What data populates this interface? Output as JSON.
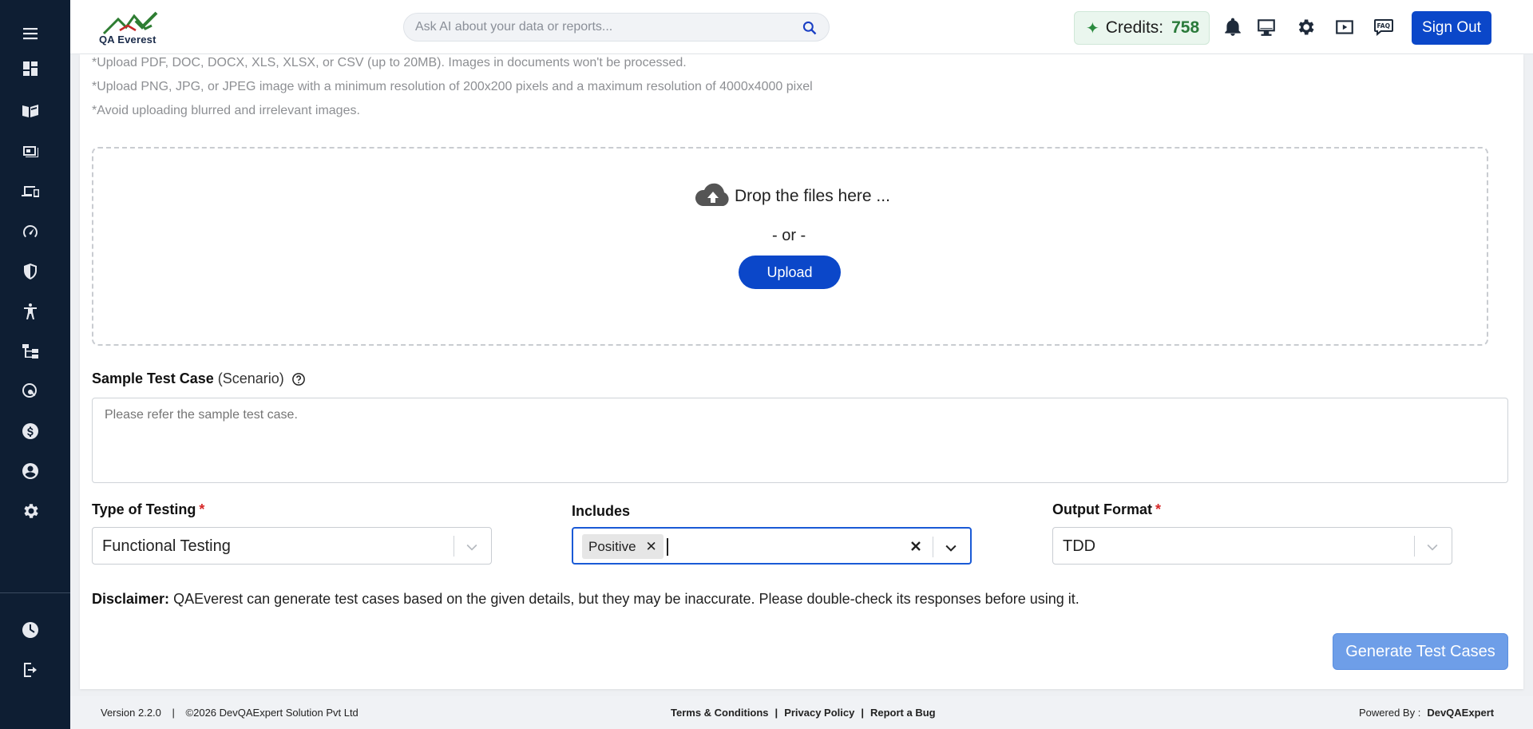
{
  "header": {
    "logo_text": "QA Everest",
    "search_placeholder": "Ask AI about your data or reports...",
    "credits_label": "Credits:",
    "credits_value": "758",
    "signout_label": "Sign Out"
  },
  "upload": {
    "notes": [
      "*Upload PDF, DOC, DOCX, XLS, XLSX, or CSV (up to 20MB). Images in documents won't be processed.",
      "*Upload PNG, JPG, or JPEG image with a minimum resolution of 200x200 pixels and a maximum resolution of 4000x4000 pixel",
      "*Avoid uploading blurred and irrelevant images."
    ],
    "drop_text": "Drop the files here ...",
    "or_text": "- or -",
    "upload_label": "Upload"
  },
  "sample": {
    "label": "Sample Test Case",
    "sub_label": "(Scenario)",
    "placeholder": "Please refer the sample test case."
  },
  "type_of_testing": {
    "label": "Type of Testing",
    "required": "*",
    "value": "Functional Testing"
  },
  "includes": {
    "label": "Includes",
    "chip": "Positive"
  },
  "output_format": {
    "label": "Output Format",
    "required": "*",
    "value": "TDD"
  },
  "disclaimer": {
    "title": "Disclaimer:",
    "text": "QAEverest can generate test cases based on the given details, but they may be inaccurate. Please double-check its responses before using it."
  },
  "generate_label": "Generate Test Cases",
  "footer": {
    "version": "Version 2.2.0",
    "divider": "|",
    "copyright": "©2026 DevQAExpert Solution Pvt Ltd",
    "terms": "Terms & Conditions",
    "privacy": "Privacy Policy",
    "bug": "Report a Bug",
    "powered_by": "Powered By :",
    "powered_name": "DevQAExpert"
  },
  "colors": {
    "sidebar": "#0e1e33",
    "primary": "#0b47c9",
    "generate": "#6e9ee8",
    "credits_green": "#2a7a3a",
    "required": "#d62828"
  },
  "icons": [
    "menu-icon",
    "dashboard-icon",
    "book-icon",
    "slides-icon",
    "devices-icon",
    "speedometer-icon",
    "shield-icon",
    "accessibility-icon",
    "hierarchy-icon",
    "search-web-icon",
    "dollar-icon",
    "user-circle-icon",
    "gear-icon",
    "help-circle-icon",
    "logout-icon"
  ]
}
